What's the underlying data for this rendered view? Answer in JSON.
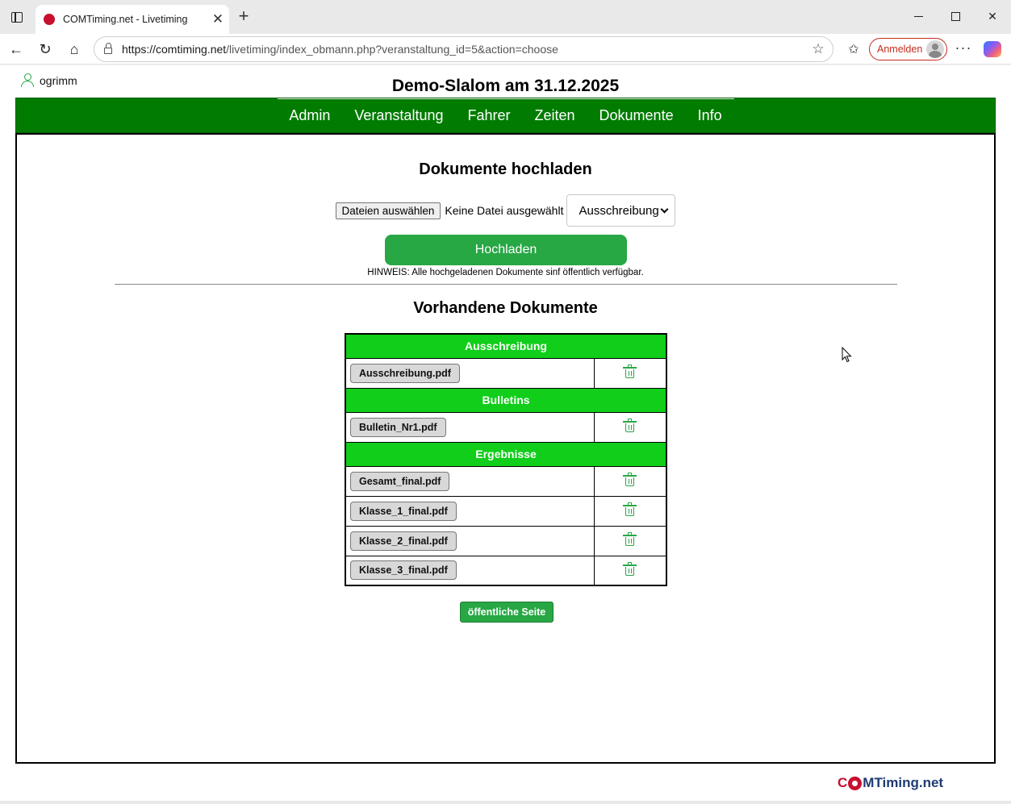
{
  "browser": {
    "tab_title": "COMTiming.net - Livetiming",
    "url_host": "https://comtiming.net",
    "url_path": "/livetiming/index_obmann.php?veranstaltung_id=5&action=choose",
    "signin_label": "Anmelden",
    "accent_color": "#c42b1c"
  },
  "header": {
    "username": "ogrimm",
    "title": "Demo-Slalom am 31.12.2025"
  },
  "nav": {
    "items": [
      "Admin",
      "Veranstaltung",
      "Fahrer",
      "Zeiten",
      "Dokumente",
      "Info"
    ],
    "background_color": "#017c01"
  },
  "upload": {
    "heading": "Dokumente hochladen",
    "file_button": "Dateien auswählen",
    "file_status": "Keine Datei ausgewählt",
    "category_selected": "Ausschreibung",
    "submit_label": "Hochladen",
    "hint": "HINWEIS: Alle hochgeladenen Dokumente sinf öffentlich verfügbar."
  },
  "documents": {
    "heading": "Vorhandene Dokumente",
    "header_color": "#10ce1a",
    "groups": [
      {
        "name": "Ausschreibung",
        "files": [
          "Ausschreibung.pdf"
        ]
      },
      {
        "name": "Bulletins",
        "files": [
          "Bulletin_Nr1.pdf"
        ]
      },
      {
        "name": "Ergebnisse",
        "files": [
          "Gesamt_final.pdf",
          "Klasse_1_final.pdf",
          "Klasse_2_final.pdf",
          "Klasse_3_final.pdf"
        ]
      }
    ]
  },
  "footer": {
    "public_page_button": "öffentliche Seite",
    "logo_prefix": "C",
    "logo_suffix": "MTiming.net"
  }
}
